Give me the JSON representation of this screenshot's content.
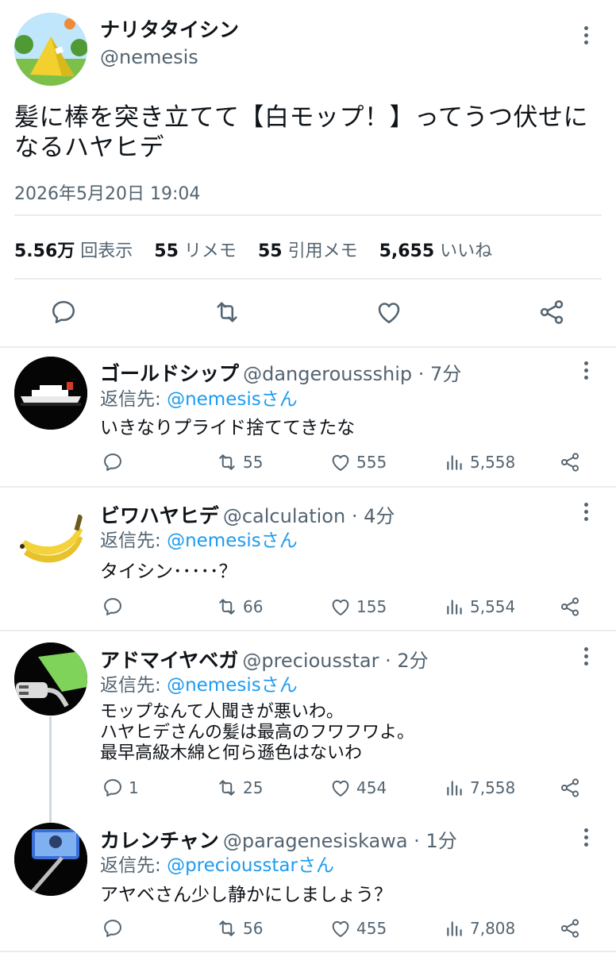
{
  "main_post": {
    "display_name": "ナリタタイシン",
    "handle": "@nemesis",
    "text_line1": "髪に棒を突き立てて【白モップ！】ってうつ伏せに",
    "text_line2": "なるハヤヒデ",
    "timestamp": "2026年5月20日 19:04",
    "stats": {
      "views_value": "5.56万",
      "views_label": "回表示",
      "reposts_value": "55",
      "reposts_label": "リメモ",
      "quotes_value": "55",
      "quotes_label": "引用メモ",
      "likes_value": "5,655",
      "likes_label": "いいね"
    }
  },
  "replies": [
    {
      "display_name": "ゴールドシップ",
      "handle": "@dangeroussship",
      "time": "7分",
      "reply_prefix": "返信先: ",
      "reply_to": "@nemesisさん",
      "text": [
        "いきなりプライド捨ててきたな"
      ],
      "comments": "",
      "reposts": "55",
      "likes": "555",
      "views": "5,558"
    },
    {
      "display_name": "ビワハヤヒデ",
      "handle": "@calculation",
      "time": "4分",
      "reply_prefix": "返信先: ",
      "reply_to": "@nemesisさん",
      "text": [
        "タイシン･････？"
      ],
      "comments": "",
      "reposts": "66",
      "likes": "155",
      "views": "5,554"
    },
    {
      "display_name": "アドマイヤベガ",
      "handle": "@preciousstar",
      "time": "2分",
      "reply_prefix": "返信先: ",
      "reply_to": "@nemesisさん",
      "text": [
        "モップなんて人聞きが悪いわ。",
        "ハヤヒデさんの髪は最高のフワフワよ。",
        "最早高級木綿と何ら遜色はないわ"
      ],
      "comments": "1",
      "reposts": "25",
      "likes": "454",
      "views": "7,558"
    },
    {
      "display_name": "カレンチャン",
      "handle": "@paragenesiskawa",
      "time": "1分",
      "reply_prefix": "返信先: ",
      "reply_to": "@preciousstarさん",
      "text": [
        "アヤベさん少し静かにしましょう？"
      ],
      "comments": "",
      "reposts": "56",
      "likes": "455",
      "views": "7,808"
    }
  ],
  "separator": " · ",
  "colors": {
    "accent": "#1d9bf0",
    "muted": "#536471",
    "text": "#0f1419",
    "divider": "#e8ecef"
  }
}
